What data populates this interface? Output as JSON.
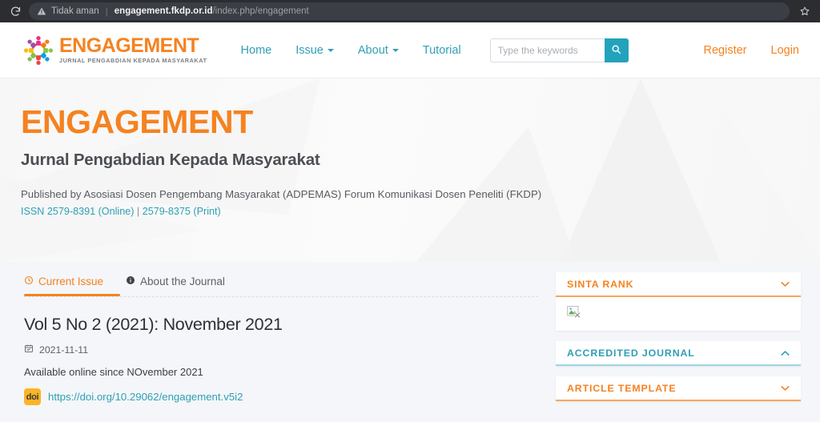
{
  "browser": {
    "reload_icon": "reload-icon",
    "warning_icon": "warning-triangle-icon",
    "security_label": "Tidak aman",
    "url_domain": "engagement.fkdp.or.id",
    "url_path": "/index.php/engagement",
    "bookmark_icon": "star-icon"
  },
  "header": {
    "logo_icon": "engagement-people-circle-logo",
    "brand_name_part1": "ENGAGEMENT",
    "brand_tagline": "JURNAL PENGABDIAN KEPADA MASYARAKAT",
    "nav": [
      {
        "label": "Home",
        "has_caret": false
      },
      {
        "label": "Issue",
        "has_caret": true
      },
      {
        "label": "About",
        "has_caret": true
      },
      {
        "label": "Tutorial",
        "has_caret": false
      }
    ],
    "search": {
      "placeholder": "Type the keywords",
      "value": "",
      "button_icon": "search-icon"
    },
    "user_links": [
      {
        "label": "Register"
      },
      {
        "label": "Login"
      }
    ]
  },
  "hero": {
    "title": "ENGAGEMENT",
    "subtitle": "Jurnal Pengabdian Kepada Masyarakat",
    "publisher": "Published by Asosiasi Dosen Pengembang Masyarakat (ADPEMAS) Forum Komunikasi Dosen Peneliti (FKDP)",
    "issn_online": "ISSN 2579-8391 (Online)",
    "issn_separator": "|",
    "issn_print": "2579-8375 (Print)"
  },
  "main": {
    "tabs": [
      {
        "label": "Current Issue",
        "icon": "clock-icon",
        "active": true
      },
      {
        "label": "About the Journal",
        "icon": "info-circle-icon",
        "active": false
      }
    ],
    "issue_title": "Vol 5 No 2 (2021): November 2021",
    "issue_date": "2021-11-11",
    "issue_date_icon": "calendar-icon",
    "availability_note": "Available online since NOvember 2021",
    "doi_badge_label": "doi",
    "doi_link": "https://doi.org/10.29062/engagement.v5i2"
  },
  "sidebar": {
    "panels": [
      {
        "title": "SINTA RANK",
        "accent": "orange",
        "chevron": "chevron-down-icon",
        "expanded": true,
        "body_icon": "broken-image-icon"
      },
      {
        "title": "ACCREDITED JOURNAL",
        "accent": "teal",
        "chevron": "chevron-up-icon",
        "expanded": false,
        "body_icon": ""
      },
      {
        "title": "ARTICLE TEMPLATE",
        "accent": "orange",
        "chevron": "chevron-down-icon",
        "expanded": false,
        "body_icon": ""
      }
    ]
  },
  "colors": {
    "brand_orange": "#f58220",
    "brand_teal": "#2f9fb5",
    "search_button": "#23a3bb",
    "doi_badge": "#fcb426",
    "content_bg": "#f4f6f9",
    "chrome_bg": "#2b2d31"
  }
}
